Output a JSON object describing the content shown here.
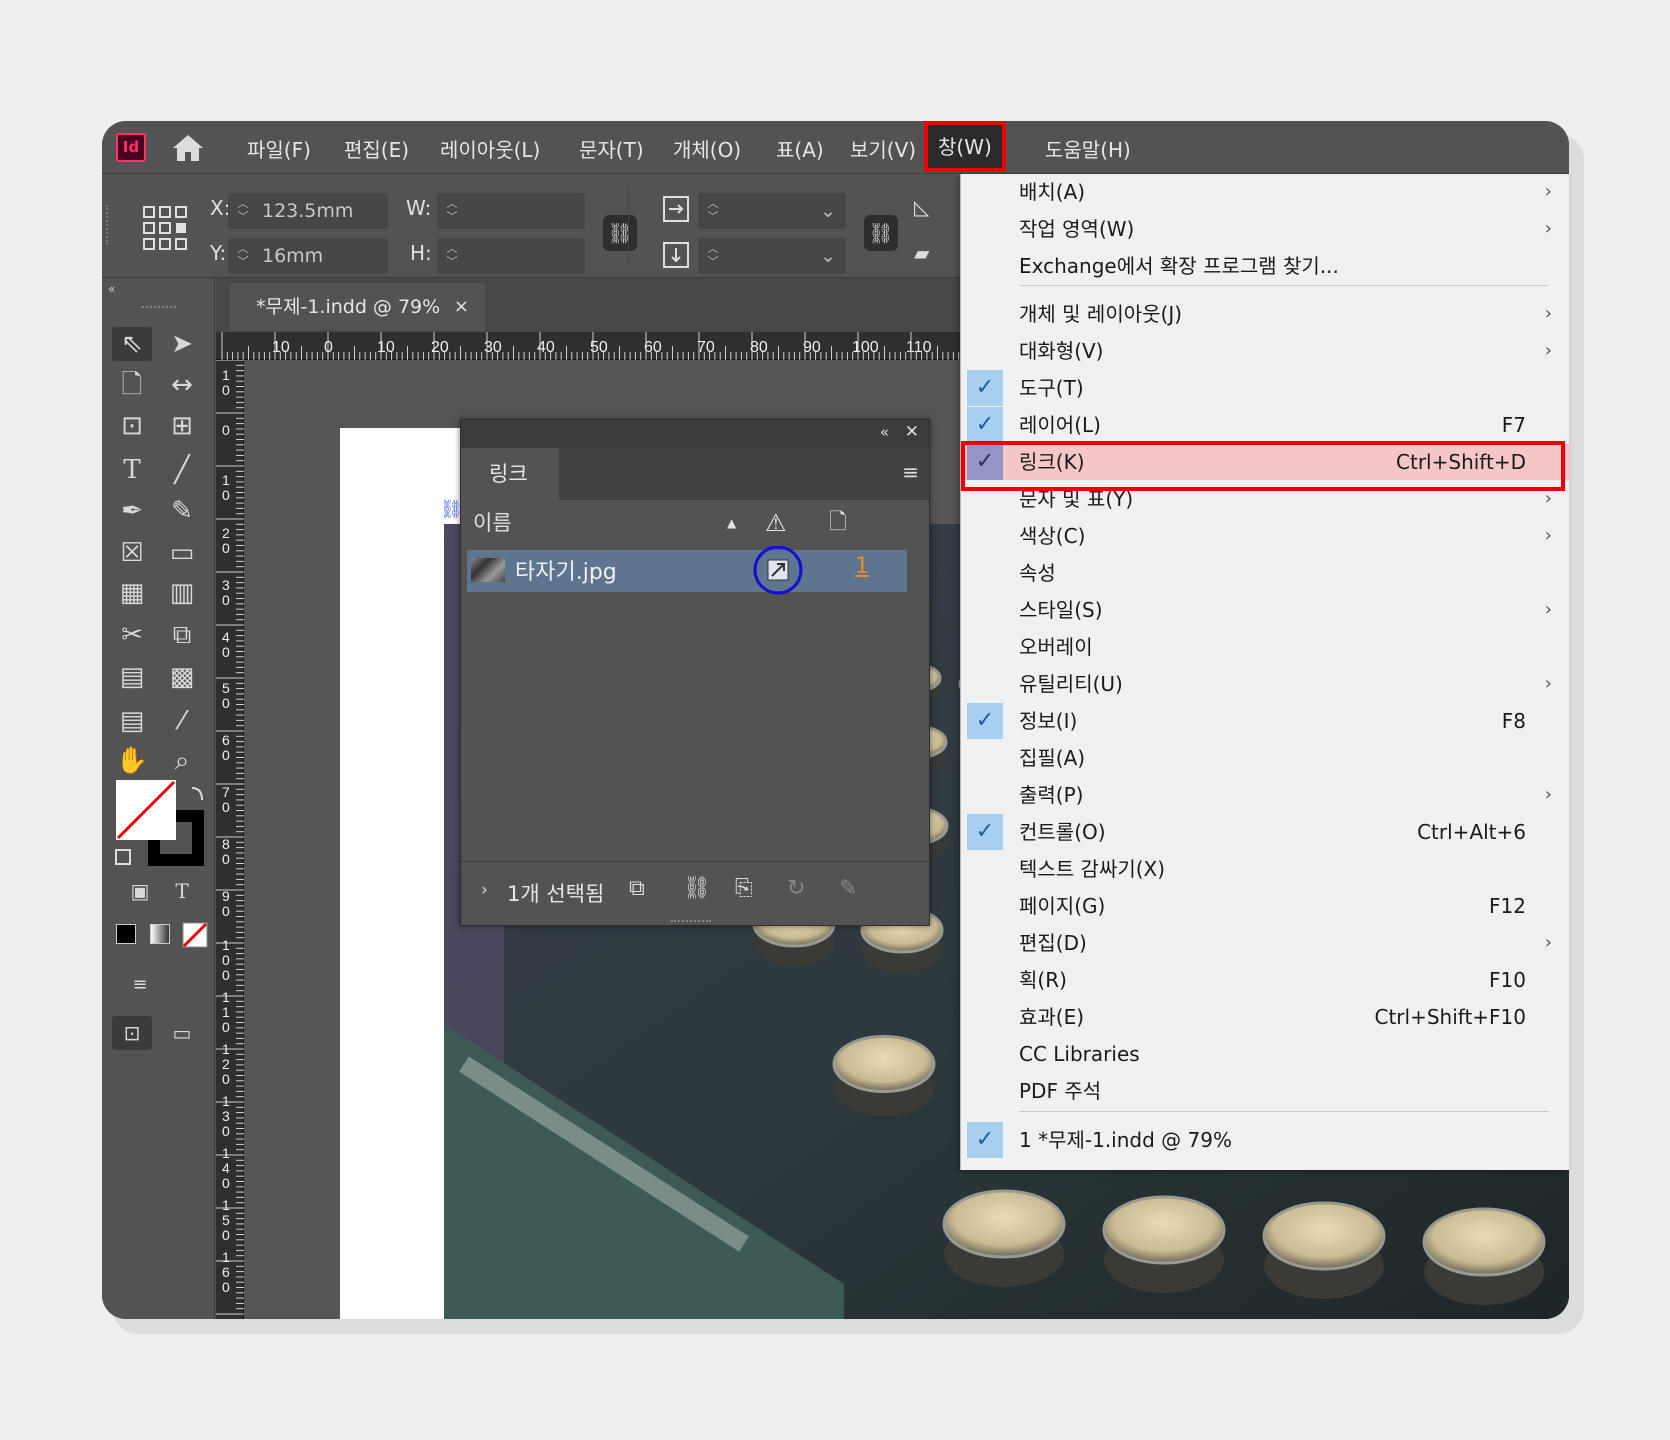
{
  "app": {
    "logo": "Id",
    "home_icon": "home-icon"
  },
  "menubar": {
    "items": [
      "파일(F)",
      "편집(E)",
      "레이아웃(L)",
      "문자(T)",
      "개체(O)",
      "표(A)",
      "보기(V)",
      "창(W)",
      "도움말(H)"
    ],
    "active": "창(W)"
  },
  "control": {
    "x_label": "X:",
    "x_value": "123.5mm",
    "y_label": "Y:",
    "y_value": "16mm",
    "w_label": "W:",
    "h_label": "H:"
  },
  "document": {
    "tab": "*무제-1.indd @ 79%",
    "close": "×"
  },
  "ruler": {
    "h_ticks": [
      "10",
      "0",
      "10",
      "20",
      "30",
      "40",
      "50",
      "60",
      "70",
      "80",
      "90",
      "100",
      "110"
    ],
    "v_ticks": [
      "1\n0",
      "0",
      "1\n0",
      "2\n0",
      "3\n0",
      "4\n0",
      "5\n0",
      "6\n0",
      "7\n0",
      "8\n0",
      "9\n0",
      "1\n0\n0",
      "1\n1\n0",
      "1\n2\n0",
      "1\n3\n0",
      "1\n4\n0",
      "1\n5\n0",
      "1\n6\n0"
    ]
  },
  "links_panel": {
    "tab": "링크",
    "col_name": "이름",
    "file": "타자기.jpg",
    "page": "1",
    "footer": "1개 선택됨"
  },
  "window_menu": {
    "items": [
      {
        "label": "배치(A)",
        "shortcut": "",
        "submenu": true,
        "checked": false
      },
      {
        "label": "작업 영역(W)",
        "shortcut": "",
        "submenu": true,
        "checked": false
      },
      {
        "label": "Exchange에서 확장 프로그램 찾기...",
        "shortcut": "",
        "submenu": false,
        "checked": false
      },
      {
        "label": "개체 및 레이아웃(J)",
        "shortcut": "",
        "submenu": true,
        "checked": false
      },
      {
        "label": "대화형(V)",
        "shortcut": "",
        "submenu": true,
        "checked": false
      },
      {
        "label": "도구(T)",
        "shortcut": "",
        "submenu": false,
        "checked": true
      },
      {
        "label": "레이어(L)",
        "shortcut": "F7",
        "submenu": false,
        "checked": true
      },
      {
        "label": "링크(K)",
        "shortcut": "Ctrl+Shift+D",
        "submenu": false,
        "checked": true
      },
      {
        "label": "문자 및 표(Y)",
        "shortcut": "",
        "submenu": true,
        "checked": false
      },
      {
        "label": "색상(C)",
        "shortcut": "",
        "submenu": true,
        "checked": false
      },
      {
        "label": "속성",
        "shortcut": "",
        "submenu": false,
        "checked": false
      },
      {
        "label": "스타일(S)",
        "shortcut": "",
        "submenu": true,
        "checked": false
      },
      {
        "label": "오버레이",
        "shortcut": "",
        "submenu": false,
        "checked": false
      },
      {
        "label": "유틸리티(U)",
        "shortcut": "",
        "submenu": true,
        "checked": false
      },
      {
        "label": "정보(I)",
        "shortcut": "F8",
        "submenu": false,
        "checked": true
      },
      {
        "label": "집필(A)",
        "shortcut": "",
        "submenu": false,
        "checked": false
      },
      {
        "label": "출력(P)",
        "shortcut": "",
        "submenu": true,
        "checked": false
      },
      {
        "label": "컨트롤(O)",
        "shortcut": "Ctrl+Alt+6",
        "submenu": false,
        "checked": true
      },
      {
        "label": "텍스트 감싸기(X)",
        "shortcut": "",
        "submenu": false,
        "checked": false
      },
      {
        "label": "페이지(G)",
        "shortcut": "F12",
        "submenu": false,
        "checked": false
      },
      {
        "label": "편집(D)",
        "shortcut": "",
        "submenu": true,
        "checked": false
      },
      {
        "label": "획(R)",
        "shortcut": "F10",
        "submenu": false,
        "checked": false
      },
      {
        "label": "효과(E)",
        "shortcut": "Ctrl+Shift+F10",
        "submenu": false,
        "checked": false
      },
      {
        "label": "CC Libraries",
        "shortcut": "",
        "submenu": false,
        "checked": false
      },
      {
        "label": "PDF 주석",
        "shortcut": "",
        "submenu": false,
        "checked": false
      },
      {
        "label": "1 *무제-1.indd @ 79%",
        "shortcut": "",
        "submenu": false,
        "checked": true
      }
    ],
    "highlighted": "링크(K)"
  },
  "colors": {
    "highlight_border": "#ee0000",
    "circle": "#1010d0",
    "check_bg": "#a6cff0",
    "selected_row": "#5e7590"
  }
}
